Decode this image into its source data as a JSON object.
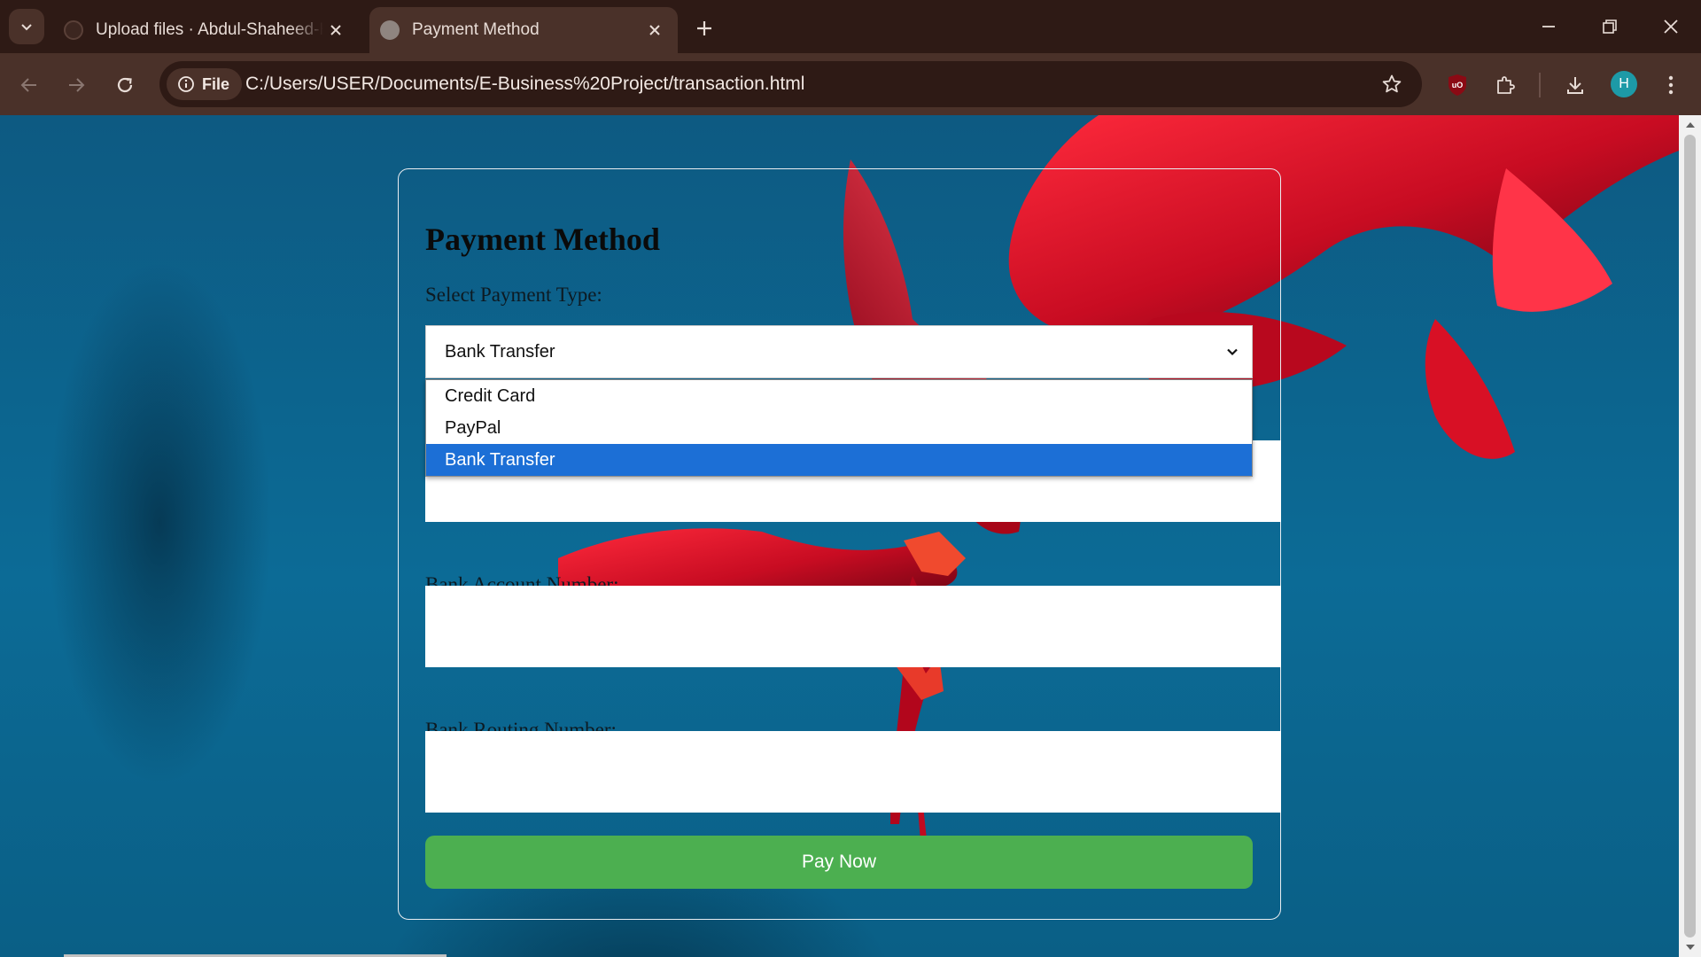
{
  "browser": {
    "tabs": [
      {
        "title": "Upload files · Abdul-Shaheed-H",
        "favicon": "github-icon",
        "active": false
      },
      {
        "title": "Payment Method",
        "favicon": "globe-icon",
        "active": true
      }
    ],
    "address_bar": {
      "scheme_chip": "File",
      "url": "C:/Users/USER/Documents/E-Business%20Project/transaction.html"
    },
    "profile_initial": "H",
    "colors": {
      "frame": "#2e1a15",
      "toolbar": "#4a3129",
      "avatar": "#1d9aa7"
    }
  },
  "page": {
    "title": "Payment Method",
    "payment_type_label": "Select Payment Type:",
    "payment_type": {
      "selected": "Bank Transfer",
      "options": [
        "Credit Card",
        "PayPal",
        "Bank Transfer"
      ]
    },
    "account_number_label": "Bank Account Number:",
    "routing_number_label": "Bank Routing Number:",
    "pay_button": "Pay Now",
    "colors": {
      "pay_button": "#4caf50",
      "option_highlight": "#1c6fd6",
      "background": "#0c6b96",
      "flower": "#d4102a"
    }
  }
}
